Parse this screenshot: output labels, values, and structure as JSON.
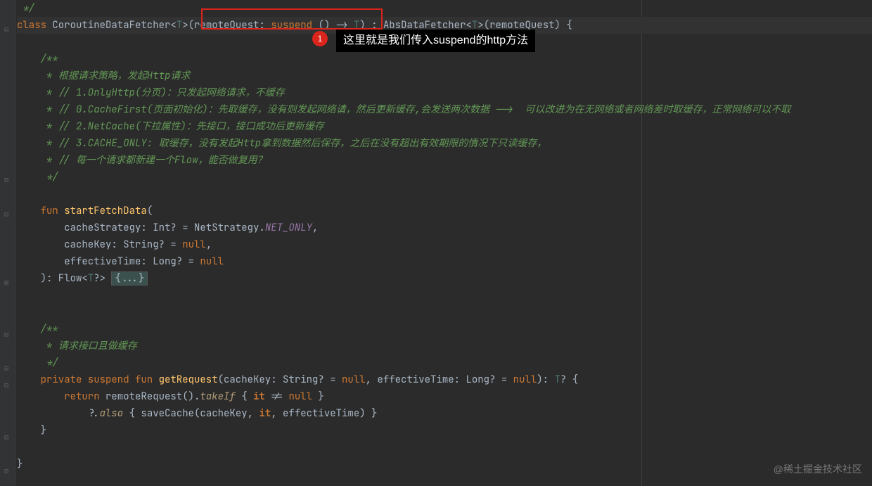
{
  "code": {
    "line0": " */",
    "line1_pre": "class ",
    "line1_class": "CoroutineDataFetcher",
    "line1_open": "<",
    "line1_t1": "T",
    "line1_close": ">",
    "line1_lparen": "(",
    "line1_param": "remoteQuest",
    "line1_colon": ": ",
    "line1_suspend": "suspend",
    "line1_arrow": " () -> ",
    "line1_t2": "T",
    "line1_rparen": ")",
    "line1_ext": " : AbsDataFetcher<",
    "line1_t3": "T",
    "line1_ext2": ">(remoteQuest) {",
    "doc1_open": "    /**",
    "doc1_l1": "     * 根据请求策略，发起Http请求",
    "doc1_l2": "     * // 1.OnlyHttp(分页)：只发起网络请求，不缓存",
    "doc1_l3": "     * // 0.CacheFirst(页面初始化)：先取缓存，没有则发起网络请，然后更新缓存,会发送两次数据 -->  可以改进为在无网络或者网络差时取缓存，正常网络可以不取",
    "doc1_l4": "     * // 2.NetCache(下拉属性)：先接口，接口成功后更新缓存",
    "doc1_l5": "     * // 3.CACHE_ONLY: 取缓存，没有发起Http拿到数据然后保存，之后在没有超出有效期限的情况下只读缓存，",
    "doc1_l6": "     * // 每一个请求都新建一个Flow，能否做复用？",
    "doc1_close": "     */",
    "fn1_kw": "    fun ",
    "fn1_name": "startFetchData",
    "fn1_open": "(",
    "fn1_p1_name": "        cacheStrategy: ",
    "fn1_p1_type": "Int",
    "fn1_p1_q": "? = NetStrategy.",
    "fn1_p1_const": "NET_ONLY",
    "fn1_p1_end": ",",
    "fn1_p2_name": "        cacheKey: ",
    "fn1_p2_type": "String",
    "fn1_p2_q": "? = ",
    "fn1_p2_null": "null",
    "fn1_p2_end": ",",
    "fn1_p3_name": "        effectiveTime: ",
    "fn1_p3_type": "Long",
    "fn1_p3_q": "? = ",
    "fn1_p3_null": "null",
    "fn1_ret": "    ): Flow<",
    "fn1_ret_t": "T",
    "fn1_ret_q": "?> ",
    "fn1_fold": "{...}",
    "doc2_open": "    /**",
    "doc2_l1": "     * 请求接口且做缓存",
    "doc2_close": "     */",
    "fn2_kw": "    private suspend fun ",
    "fn2_name": "getRequest",
    "fn2_sig1": "(cacheKey: ",
    "fn2_sig1_type": "String",
    "fn2_sig1_q": "? = ",
    "fn2_sig1_null": "null",
    "fn2_sig2": ", effectiveTime: ",
    "fn2_sig2_type": "Long",
    "fn2_sig2_q": "? = ",
    "fn2_sig2_null": "null",
    "fn2_sig3": "): ",
    "fn2_ret_t": "T",
    "fn2_sig4": "? {",
    "fn2_body1_ret": "        return ",
    "fn2_body1_call": "remoteRequest().",
    "fn2_body1_takeif": "takeIf",
    "fn2_body1_lam": " { ",
    "fn2_body1_it": "it",
    "fn2_body1_neq": " != ",
    "fn2_body1_null": "null",
    "fn2_body1_end": " }",
    "fn2_body2_pre": "            ?.",
    "fn2_body2_also": "also",
    "fn2_body2_lam": " { saveCache(cacheKey, ",
    "fn2_body2_it": "it",
    "fn2_body2_end": ", effectiveTime) }",
    "fn2_close": "    }",
    "class_close": "}"
  },
  "annotation": {
    "badge": "1",
    "tooltip": "这里就是我们传入suspend的http方法"
  },
  "watermark": "@稀土掘金技术社区"
}
